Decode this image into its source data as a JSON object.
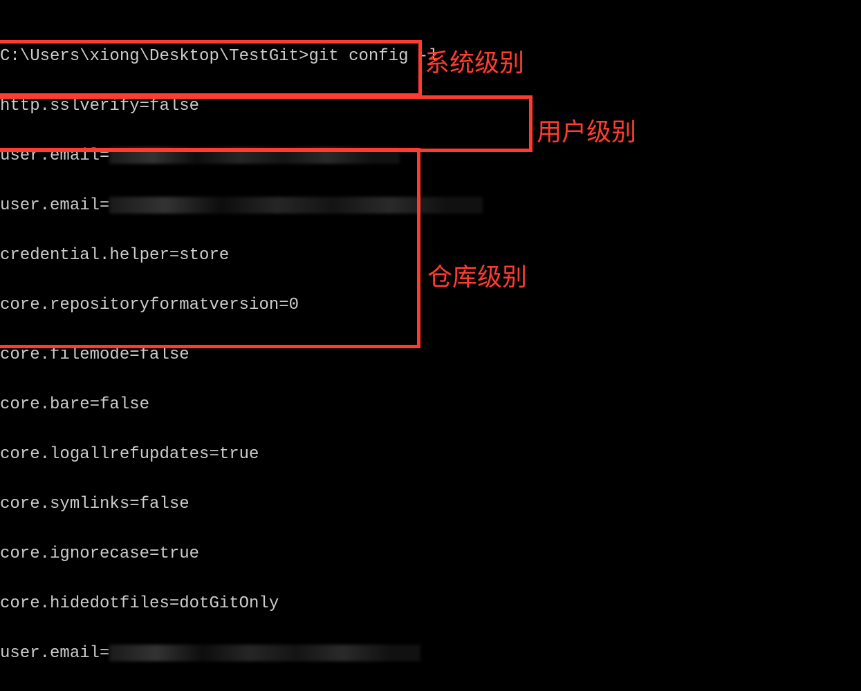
{
  "terminal": {
    "prompt": "C:\\Users\\xiong\\Desktop\\TestGit>",
    "command": "git config -l",
    "lines": {
      "l1": "http.sslverify=false",
      "l2_prefix": "user.email=",
      "l3_prefix": "user.email=",
      "l4": "credential.helper=store",
      "l5": "core.repositoryformatversion=0",
      "l6": "core.filemode=false",
      "l7": "core.bare=false",
      "l8": "core.logallrefupdates=true",
      "l9": "core.symlinks=false",
      "l10": "core.ignorecase=true",
      "l11": "core.hidedotfiles=dotGitOnly",
      "l12_prefix": "user.email="
    }
  },
  "annotations": {
    "system_level": "系统级别",
    "user_level": "用户级别",
    "repo_level": "仓库级别"
  }
}
